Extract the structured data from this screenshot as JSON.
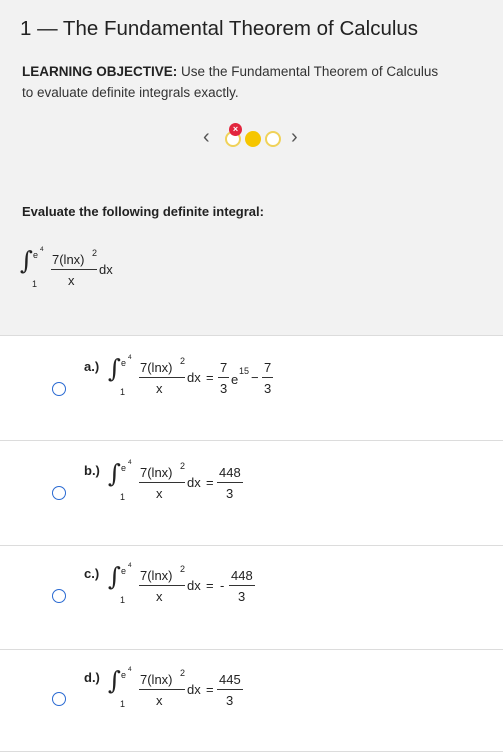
{
  "page": {
    "title": "1 — The Fundamental Theorem of Calculus",
    "objective_label": "LEARNING OBJECTIVE:",
    "objective_text_1": "Use the Fundamental Theorem of Calculus",
    "objective_text_2": "to evaluate definite integrals exactly."
  },
  "pager": {
    "prev_icon": "‹",
    "next_icon": "›",
    "incorrect_badge": "×",
    "colors": {
      "incorrect": "#e2263e",
      "current": "#f6c600",
      "outline": "#f0d259"
    }
  },
  "question": {
    "prompt": "Evaluate the following definite integral:",
    "integral": {
      "sign": "∫",
      "upper": "e",
      "upper_exp": "4",
      "lower": "1",
      "numerator": "7(lnx)",
      "numerator_exp": "2",
      "denominator": "x",
      "differential": "dx"
    }
  },
  "options": [
    {
      "label": "a.)",
      "equals": "=",
      "rhs": {
        "frac1_num": "7",
        "frac1_den": "3",
        "e": "e",
        "e_exp": "15",
        "minus": "−",
        "frac2_num": "7",
        "frac2_den": "3"
      }
    },
    {
      "label": "b.)",
      "equals": "=",
      "rhs": {
        "num": "448",
        "den": "3"
      }
    },
    {
      "label": "c.)",
      "equals": "=",
      "rhs": {
        "sign": "-",
        "num": "448",
        "den": "3"
      }
    },
    {
      "label": "d.)",
      "equals": "=",
      "rhs": {
        "num": "445",
        "den": "3"
      }
    }
  ]
}
